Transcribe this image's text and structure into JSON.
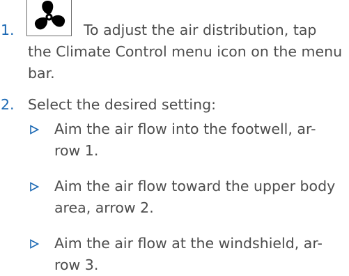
{
  "steps": [
    {
      "number": "1.",
      "icon": "fan-icon",
      "first_line": "To adjust the air distribution, tap",
      "rest_lines": [
        "the Climate Control menu icon on the menu",
        "bar."
      ]
    },
    {
      "number": "2.",
      "text": "Select the desired setting:"
    }
  ],
  "bullets": [
    {
      "lines": [
        "Aim the air flow into the footwell, ar-",
        "row 1."
      ]
    },
    {
      "lines": [
        "Aim the air flow toward the upper body",
        "area, arrow 2."
      ]
    },
    {
      "lines": [
        "Aim the air flow at the windshield, ar-",
        "row 3."
      ]
    }
  ],
  "colors": {
    "step_number": "#1c69b4",
    "bullet_marker": "#1c69b4",
    "text": "#4d4d4d"
  }
}
